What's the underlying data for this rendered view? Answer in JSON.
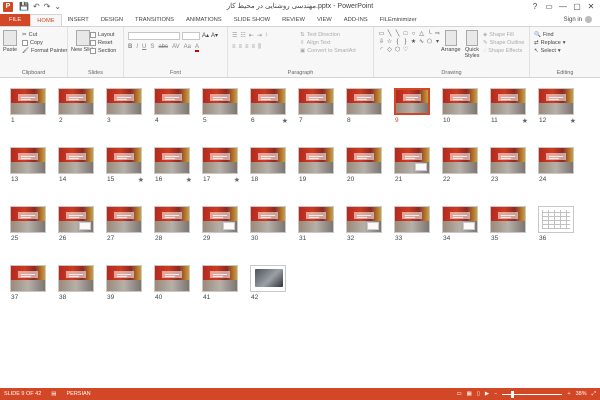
{
  "window": {
    "title": "مهندسی روشنایی در محیط کار.pptx - PowerPoint",
    "controls": [
      "?",
      "▭",
      "—",
      "▢",
      "✕"
    ]
  },
  "qat": {
    "save": "💾",
    "undo": "↶",
    "redo": "↷",
    "more": "⌄"
  },
  "tabs": [
    {
      "label": "FILE",
      "kind": "file"
    },
    {
      "label": "HOME",
      "kind": "active"
    },
    {
      "label": "INSERT",
      "kind": ""
    },
    {
      "label": "DESIGN",
      "kind": ""
    },
    {
      "label": "TRANSITIONS",
      "kind": ""
    },
    {
      "label": "ANIMATIONS",
      "kind": ""
    },
    {
      "label": "SLIDE SHOW",
      "kind": ""
    },
    {
      "label": "REVIEW",
      "kind": ""
    },
    {
      "label": "VIEW",
      "kind": ""
    },
    {
      "label": "ADD-INS",
      "kind": ""
    },
    {
      "label": "FILEminimizer",
      "kind": ""
    }
  ],
  "signin": "Sign in",
  "ribbon": {
    "clipboard": {
      "label": "Clipboard",
      "paste": "Paste",
      "cut": "Cut",
      "copy": "Copy",
      "format_painter": "Format Painter"
    },
    "slides": {
      "label": "Slides",
      "new_slide": "New Slide",
      "layout": "Layout",
      "reset": "Reset",
      "section": "Section"
    },
    "font": {
      "label": "Font"
    },
    "paragraph": {
      "label": "Paragraph",
      "text_direction": "Text Direction",
      "align_text": "Align Text",
      "convert_smartart": "Convert to SmartArt"
    },
    "drawing": {
      "label": "Drawing",
      "arrange": "Arrange",
      "quick_styles": "Quick Styles",
      "shape_fill": "Shape Fill",
      "shape_outline": "Shape Outline",
      "shape_effects": "Shape Effects"
    },
    "editing": {
      "label": "Editing",
      "find": "Find",
      "replace": "Replace",
      "select": "Select"
    }
  },
  "slides": [
    {
      "n": "1",
      "star": false,
      "kind": "std"
    },
    {
      "n": "2",
      "star": false,
      "kind": "std"
    },
    {
      "n": "3",
      "star": false,
      "kind": "std"
    },
    {
      "n": "4",
      "star": false,
      "kind": "std"
    },
    {
      "n": "5",
      "star": false,
      "kind": "std"
    },
    {
      "n": "6",
      "star": true,
      "kind": "std"
    },
    {
      "n": "7",
      "star": false,
      "kind": "std"
    },
    {
      "n": "8",
      "star": false,
      "kind": "std"
    },
    {
      "n": "9",
      "star": false,
      "kind": "std",
      "selected": true
    },
    {
      "n": "10",
      "star": false,
      "kind": "std"
    },
    {
      "n": "11",
      "star": true,
      "kind": "std"
    },
    {
      "n": "12",
      "star": true,
      "kind": "std"
    },
    {
      "n": "13",
      "star": false,
      "kind": "std"
    },
    {
      "n": "14",
      "star": false,
      "kind": "std"
    },
    {
      "n": "15",
      "star": true,
      "kind": "std"
    },
    {
      "n": "16",
      "star": true,
      "kind": "std"
    },
    {
      "n": "17",
      "star": true,
      "kind": "std"
    },
    {
      "n": "18",
      "star": false,
      "kind": "std"
    },
    {
      "n": "19",
      "star": false,
      "kind": "std"
    },
    {
      "n": "20",
      "star": false,
      "kind": "std"
    },
    {
      "n": "21",
      "star": false,
      "kind": "white"
    },
    {
      "n": "22",
      "star": false,
      "kind": "std"
    },
    {
      "n": "23",
      "star": false,
      "kind": "std"
    },
    {
      "n": "24",
      "star": false,
      "kind": "std"
    },
    {
      "n": "25",
      "star": false,
      "kind": "std"
    },
    {
      "n": "26",
      "star": false,
      "kind": "white"
    },
    {
      "n": "27",
      "star": false,
      "kind": "std"
    },
    {
      "n": "28",
      "star": false,
      "kind": "std"
    },
    {
      "n": "29",
      "star": false,
      "kind": "white"
    },
    {
      "n": "30",
      "star": false,
      "kind": "std"
    },
    {
      "n": "31",
      "star": false,
      "kind": "std"
    },
    {
      "n": "32",
      "star": false,
      "kind": "white"
    },
    {
      "n": "33",
      "star": false,
      "kind": "std"
    },
    {
      "n": "34",
      "star": false,
      "kind": "white"
    },
    {
      "n": "35",
      "star": false,
      "kind": "std"
    },
    {
      "n": "36",
      "star": false,
      "kind": "table"
    },
    {
      "n": "37",
      "star": false,
      "kind": "std"
    },
    {
      "n": "38",
      "star": false,
      "kind": "std"
    },
    {
      "n": "39",
      "star": false,
      "kind": "std"
    },
    {
      "n": "40",
      "star": false,
      "kind": "std"
    },
    {
      "n": "41",
      "star": false,
      "kind": "std"
    },
    {
      "n": "42",
      "star": false,
      "kind": "photo"
    }
  ],
  "status": {
    "slide_of": "SLIDE 9 OF 42",
    "language": "PERSIAN",
    "zoom": "38%",
    "zoom_minus": "−",
    "zoom_plus": "+"
  },
  "colors": {
    "accent": "#d24726"
  },
  "selected_slide_index": 8
}
